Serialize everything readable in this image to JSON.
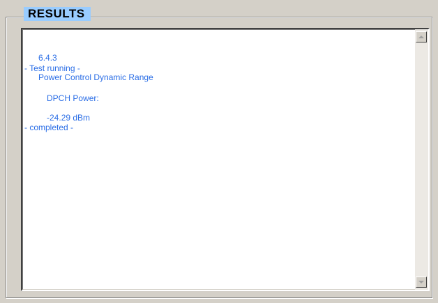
{
  "results_group": {
    "title": "RESULTS"
  },
  "log": {
    "test_id": "6.4.3",
    "test_name": "Power Control Dynamic Range",
    "status_running": "- Test running -",
    "measurement_label": "DPCH Power:",
    "measurement_value": "-24.29 dBm",
    "status_completed": "- completed -"
  },
  "scrollbar": {
    "up_icon": "arrow-up-icon",
    "down_icon": "arrow-down-icon"
  },
  "colors": {
    "log_text": "#2b6ee6",
    "title_background": "#99ccff",
    "window_background": "#d4d0c8"
  }
}
